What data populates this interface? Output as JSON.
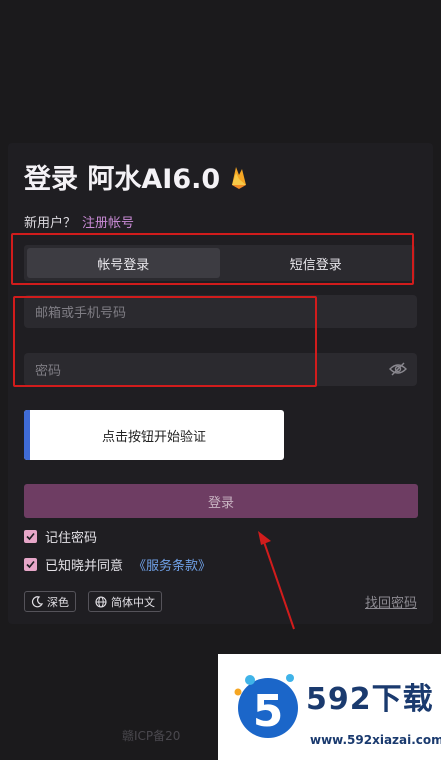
{
  "title": "登录 阿水AI6.0",
  "new_user": {
    "label": "新用户？",
    "register_link": "注册帐号"
  },
  "tabs": [
    {
      "label": "帐号登录"
    },
    {
      "label": "短信登录"
    }
  ],
  "fields": {
    "account_placeholder": "邮箱或手机号码",
    "password_placeholder": "密码"
  },
  "verify_button": "点击按钮开始验证",
  "login_button": "登录",
  "remember": {
    "label": "记住密码",
    "checked": true
  },
  "agree": {
    "label": "已知晓并同意",
    "terms_link": "《服务条款》",
    "checked": true
  },
  "theme_button": "深色",
  "language_button": "简体中文",
  "forgot_link": "找回密码",
  "footer_icp": "赣ICP备20",
  "watermark": {
    "name": "592下载",
    "url": "www.592xiazai.com",
    "logo_digit": "5"
  },
  "colors": {
    "accent": "#c98bd6",
    "login_bg": "#6e3d63",
    "annotation": "#d11c1c",
    "terms": "#6fa0e6"
  }
}
